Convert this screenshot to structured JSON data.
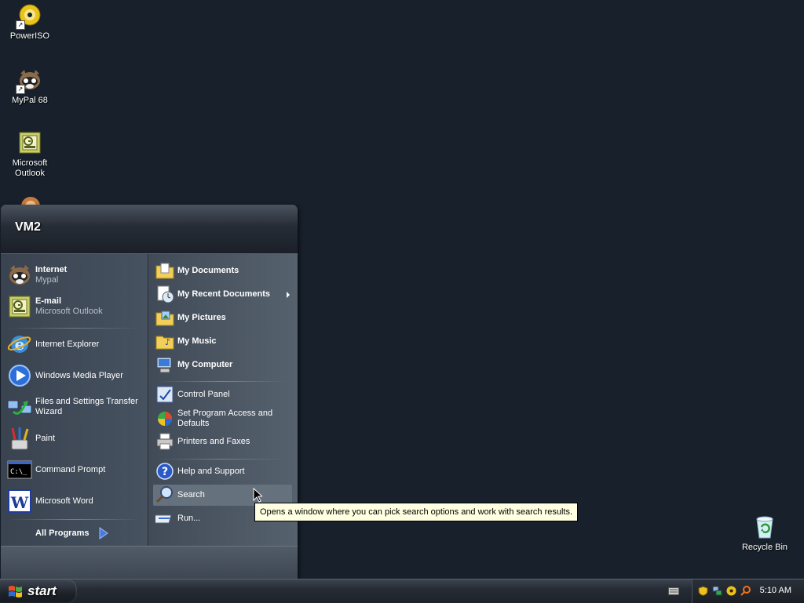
{
  "desktop": {
    "icons": [
      {
        "label": "PowerISO"
      },
      {
        "label": "MyPal 68"
      },
      {
        "label": "Microsoft Outlook"
      },
      {
        "label": "Recycle Bin"
      }
    ]
  },
  "start_menu": {
    "user_name": "VM2",
    "pinned": [
      {
        "title": "Internet",
        "subtitle": "Mypal"
      },
      {
        "title": "E-mail",
        "subtitle": "Microsoft Outlook"
      }
    ],
    "recent": [
      {
        "label": "Internet Explorer"
      },
      {
        "label": "Windows Media Player"
      },
      {
        "label": "Files and Settings Transfer Wizard"
      },
      {
        "label": "Paint"
      },
      {
        "label": "Command Prompt"
      },
      {
        "label": "Microsoft Word"
      }
    ],
    "all_programs_label": "All Programs",
    "places": [
      {
        "label": "My Documents"
      },
      {
        "label": "My Recent Documents"
      },
      {
        "label": "My Pictures"
      },
      {
        "label": "My Music"
      },
      {
        "label": "My Computer"
      }
    ],
    "settings": [
      {
        "label": "Control Panel"
      },
      {
        "label": "Set Program Access and Defaults"
      },
      {
        "label": "Printers and Faxes"
      }
    ],
    "tools": [
      {
        "label": "Help and Support"
      },
      {
        "label": "Search"
      },
      {
        "label": "Run..."
      }
    ]
  },
  "tooltip": {
    "text": "Opens a window where you can pick search options and work with search results."
  },
  "taskbar": {
    "start_label": "start",
    "clock": "5:10 AM"
  },
  "colors": {
    "desktop_bg": "#17202b",
    "menu_panel": "#3b4552",
    "highlight": "#66717e",
    "tooltip_bg": "#ffffe1"
  }
}
